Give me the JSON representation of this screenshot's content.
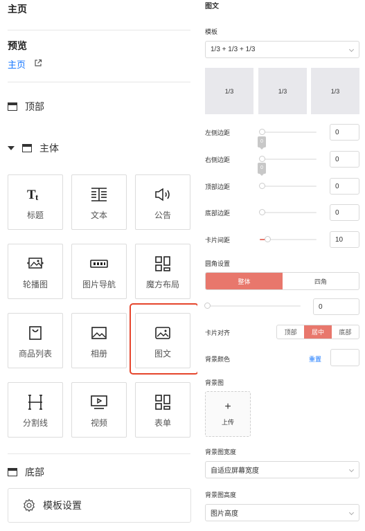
{
  "left": {
    "header_title": "主页",
    "preview_title": "预览",
    "home_link": "主页",
    "top_section": "顶部",
    "body_section": "主体",
    "bottom_section": "底部",
    "components": [
      {
        "label": "标题",
        "icon": "title-icon"
      },
      {
        "label": "文本",
        "icon": "text-icon"
      },
      {
        "label": "公告",
        "icon": "notice-icon"
      },
      {
        "label": "轮播图",
        "icon": "carousel-icon"
      },
      {
        "label": "图片导航",
        "icon": "image-nav-icon"
      },
      {
        "label": "魔方布局",
        "icon": "cube-layout-icon"
      },
      {
        "label": "商品列表",
        "icon": "product-list-icon"
      },
      {
        "label": "相册",
        "icon": "album-icon"
      },
      {
        "label": "图文",
        "icon": "image-text-icon"
      },
      {
        "label": "分割线",
        "icon": "divider-icon"
      },
      {
        "label": "视频",
        "icon": "video-icon"
      },
      {
        "label": "表单",
        "icon": "form-icon"
      }
    ],
    "selected_component": "图文",
    "template_settings": "模板设置",
    "accent_color": "#1677ff",
    "highlight_color": "#e5442b"
  },
  "right": {
    "panel_title": "图文",
    "template_label": "模板",
    "template_value": "1/3 + 1/3 + 1/3",
    "preview_cells": [
      "1/3",
      "1/3",
      "1/3"
    ],
    "left_margin_label": "左侧边距",
    "left_margin_value": "0",
    "left_margin_tip": "0",
    "right_margin_label": "右侧边距",
    "right_margin_value": "0",
    "right_margin_tip": "0",
    "top_margin_label": "顶部边距",
    "top_margin_value": "0",
    "bottom_margin_label": "底部边距",
    "bottom_margin_value": "0",
    "card_gap_label": "卡片间距",
    "card_gap_value": "10",
    "radius_label": "圆角设置",
    "radius_options": [
      "整体",
      "四角"
    ],
    "radius_selected": "整体",
    "radius_value": "0",
    "align_label": "卡片对齐",
    "align_options": [
      "顶部",
      "居中",
      "底部"
    ],
    "align_selected": "居中",
    "bg_color_label": "背景颜色",
    "reset_label": "重置",
    "bg_image_label": "背景图",
    "upload_plus": "+",
    "upload_label": "上传",
    "bg_width_label": "背景图宽度",
    "bg_width_value": "自适应屏幕宽度",
    "bg_height_label": "背景图高度",
    "bg_height_value": "图片高度",
    "accent_color": "#e8776c"
  }
}
